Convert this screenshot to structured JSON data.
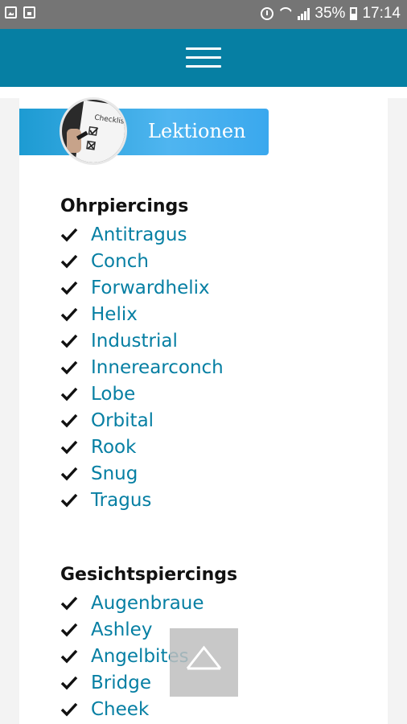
{
  "status_bar": {
    "battery_percent": "35%",
    "time": "17:14",
    "icons": [
      "image-icon",
      "lock-icon",
      "alarm-icon",
      "wifi-icon",
      "signal-icon",
      "battery-icon"
    ]
  },
  "app_bar": {
    "color": "#067fa3",
    "menu_icon": "hamburger-menu-icon"
  },
  "banner": {
    "label": "Lektionen",
    "avatar_icon": "checklist-image"
  },
  "sections": [
    {
      "title": "Ohrpiercings",
      "items": [
        "Antitragus",
        "Conch",
        "Forwardhelix",
        "Helix",
        "Industrial",
        "Innerearconch",
        "Lobe",
        "Orbital",
        "Rook",
        "Snug",
        "Tragus"
      ]
    },
    {
      "title": "Gesichtspiercings",
      "items": [
        "Augenbraue",
        "Ashley",
        "Angelbites",
        "Bridge",
        "Cheek"
      ]
    }
  ],
  "scroll_top": {
    "icon": "chevron-up-icon"
  },
  "colors": {
    "link": "#067fa3",
    "status_bar": "#757575"
  }
}
